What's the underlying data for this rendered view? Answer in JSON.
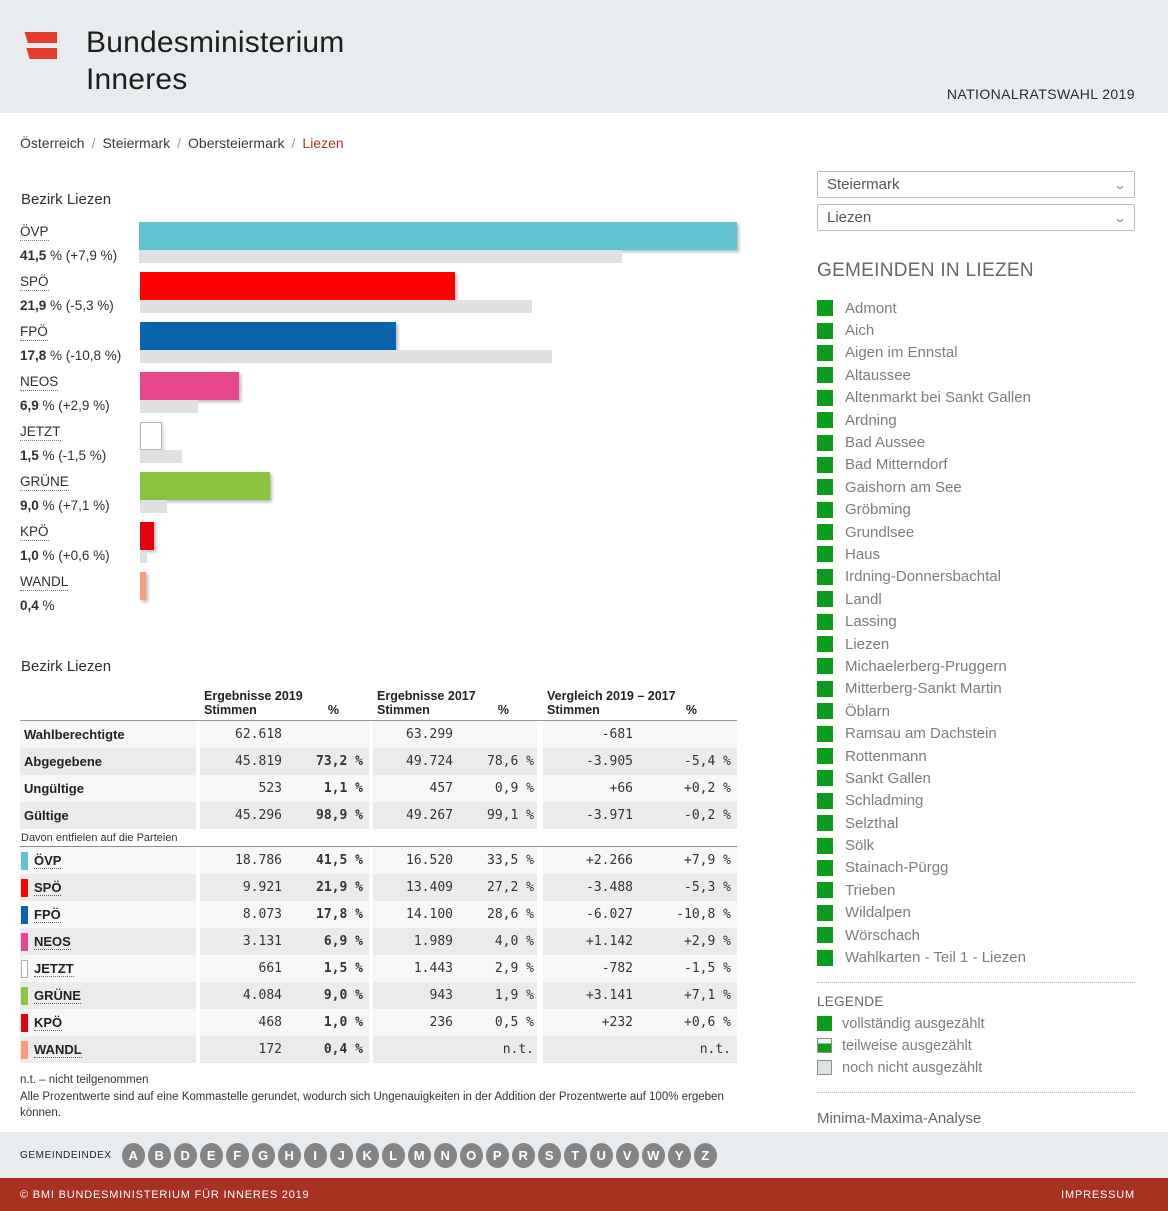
{
  "header": {
    "ministry_line1": "Bundesministerium",
    "ministry_line2": "Inneres",
    "election_label": "NATIONALRATSWAHL 2019"
  },
  "breadcrumb": {
    "items": [
      "Österreich",
      "Steiermark",
      "Obersteiermark"
    ],
    "current": "Liezen",
    "separator": "/"
  },
  "filters": {
    "state": "Steiermark",
    "district": "Liezen"
  },
  "chart_data": {
    "type": "bar",
    "orientation": "horizontal",
    "title": "Bezirk Liezen",
    "unit": "%",
    "xlim": [
      0,
      41.5
    ],
    "legend_position": "none",
    "series": [
      {
        "party": "ÖVP",
        "pct_2019": 41.5,
        "pct_2017": 33.5,
        "diff_pct": 7.9,
        "pct_label": "41,5 %",
        "diff_label": "(+7,9 %)",
        "color": "#63c2d2"
      },
      {
        "party": "SPÖ",
        "pct_2019": 21.9,
        "pct_2017": 27.2,
        "diff_pct": -5.3,
        "pct_label": "21,9 %",
        "diff_label": "(-5,3 %)",
        "color": "#fe0000"
      },
      {
        "party": "FPÖ",
        "pct_2019": 17.8,
        "pct_2017": 28.6,
        "diff_pct": -10.8,
        "pct_label": "17,8 %",
        "diff_label": "(-10,8 %)",
        "color": "#0b63ad"
      },
      {
        "party": "NEOS",
        "pct_2019": 6.9,
        "pct_2017": 4.0,
        "diff_pct": 2.9,
        "pct_label": "6,9 %",
        "diff_label": "(+2,9 %)",
        "color": "#e8478d"
      },
      {
        "party": "JETZT",
        "pct_2019": 1.5,
        "pct_2017": 2.9,
        "diff_pct": -1.5,
        "pct_label": "1,5 %",
        "diff_label": "(-1,5 %)",
        "color": "#ffffff",
        "outlined": true
      },
      {
        "party": "GRÜNE",
        "pct_2019": 9.0,
        "pct_2017": 1.9,
        "diff_pct": 7.1,
        "pct_label": "9,0 %",
        "diff_label": "(+7,1 %)",
        "color": "#8bc540"
      },
      {
        "party": "KPÖ",
        "pct_2019": 1.0,
        "pct_2017": 0.5,
        "diff_pct": 0.6,
        "pct_label": "1,0 %",
        "diff_label": "(+0,6 %)",
        "color": "#e3000f"
      },
      {
        "party": "WANDL",
        "pct_2019": 0.4,
        "pct_2017": null,
        "diff_pct": null,
        "pct_label": "0,4 %",
        "diff_label": "",
        "color": "#f89b7e"
      }
    ]
  },
  "table": {
    "title": "Bezirk Liezen",
    "group_2019": "Ergebnisse 2019",
    "group_2017": "Ergebnisse 2017",
    "group_diff": "Vergleich 2019 – 2017",
    "sub_votes": "Stimmen",
    "sub_pct": "%",
    "summary_rows": [
      {
        "label": "Wahlberechtigte",
        "s2019": "62.618",
        "p2019": "",
        "s2017": "63.299",
        "p2017": "",
        "s_diff": "-681",
        "p_diff": ""
      },
      {
        "label": "Abgegebene",
        "s2019": "45.819",
        "p2019": "73,2 %",
        "s2017": "49.724",
        "p2017": "78,6 %",
        "s_diff": "-3.905",
        "p_diff": "-5,4 %"
      },
      {
        "label": "Ungültige",
        "s2019": "523",
        "p2019": "1,1 %",
        "s2017": "457",
        "p2017": "0,9 %",
        "s_diff": "+66",
        "p_diff": "+0,2 %"
      },
      {
        "label": "Gültige",
        "s2019": "45.296",
        "p2019": "98,9 %",
        "s2017": "49.267",
        "p2017": "99,1 %",
        "s_diff": "-3.971",
        "p_diff": "-0,2 %"
      }
    ],
    "davon_label": "Davon entfielen auf die Parteien",
    "party_rows": [
      {
        "party": "ÖVP",
        "s2019": "18.786",
        "p2019": "41,5 %",
        "s2017": "16.520",
        "p2017": "33,5 %",
        "s_diff": "+2.266",
        "p_diff": "+7,9 %"
      },
      {
        "party": "SPÖ",
        "s2019": "9.921",
        "p2019": "21,9 %",
        "s2017": "13.409",
        "p2017": "27,2 %",
        "s_diff": "-3.488",
        "p_diff": "-5,3 %"
      },
      {
        "party": "FPÖ",
        "s2019": "8.073",
        "p2019": "17,8 %",
        "s2017": "14.100",
        "p2017": "28,6 %",
        "s_diff": "-6.027",
        "p_diff": "-10,8 %"
      },
      {
        "party": "NEOS",
        "s2019": "3.131",
        "p2019": "6,9 %",
        "s2017": "1.989",
        "p2017": "4,0 %",
        "s_diff": "+1.142",
        "p_diff": "+2,9 %"
      },
      {
        "party": "JETZT",
        "s2019": "661",
        "p2019": "1,5 %",
        "s2017": "1.443",
        "p2017": "2,9 %",
        "s_diff": "-782",
        "p_diff": "-1,5 %"
      },
      {
        "party": "GRÜNE",
        "s2019": "4.084",
        "p2019": "9,0 %",
        "s2017": "943",
        "p2017": "1,9 %",
        "s_diff": "+3.141",
        "p_diff": "+7,1 %"
      },
      {
        "party": "KPÖ",
        "s2019": "468",
        "p2019": "1,0 %",
        "s2017": "236",
        "p2017": "0,5 %",
        "s_diff": "+232",
        "p_diff": "+0,6 %"
      },
      {
        "party": "WANDL",
        "s2019": "172",
        "p2019": "0,4 %",
        "s2017": "",
        "p2017": "n.t.",
        "s_diff": "",
        "p_diff": "n.t."
      }
    ],
    "notes": [
      "n.t. – nicht teilgenommen",
      "Alle Prozentwerte sind auf eine Kommastelle gerundet, wodurch sich Ungenauigkeiten in der Addition der Prozentwerte auf 100% ergeben können."
    ]
  },
  "sidebar": {
    "gemeinden_title": "GEMEINDEN IN LIEZEN",
    "gemeinden": [
      "Admont",
      "Aich",
      "Aigen im Ennstal",
      "Altaussee",
      "Altenmarkt bei Sankt Gallen",
      "Ardning",
      "Bad Aussee",
      "Bad Mitterndorf",
      "Gaishorn am See",
      "Gröbming",
      "Grundlsee",
      "Haus",
      "Irdning-Donnersbachtal",
      "Landl",
      "Lassing",
      "Liezen",
      "Michaelerberg-Pruggern",
      "Mitterberg-Sankt Martin",
      "Öblarn",
      "Ramsau am Dachstein",
      "Rottenmann",
      "Sankt Gallen",
      "Schladming",
      "Selzthal",
      "Sölk",
      "Stainach-Pürgg",
      "Trieben",
      "Wildalpen",
      "Wörschach",
      "Wahlkarten - Teil 1 - Liezen"
    ],
    "status_color": "#0a9e1c",
    "legend_title": "LEGENDE",
    "legend": [
      {
        "type": "full",
        "label": "vollständig ausgezählt"
      },
      {
        "type": "partial",
        "label": "teilweise ausgezählt"
      },
      {
        "type": "none",
        "label": "noch nicht ausgezählt"
      }
    ],
    "analysis_link": "Minima-Maxima-Analyse"
  },
  "index": {
    "label": "GEMEINDEINDEX",
    "letters": [
      "A",
      "B",
      "D",
      "E",
      "F",
      "G",
      "H",
      "I",
      "J",
      "K",
      "L",
      "M",
      "N",
      "O",
      "P",
      "R",
      "S",
      "T",
      "U",
      "V",
      "W",
      "Y",
      "Z"
    ]
  },
  "footer": {
    "copyright": "© BMI BUNDESMINISTERIUM FÜR INNERES 2019",
    "impressum": "IMPRESSUM"
  }
}
